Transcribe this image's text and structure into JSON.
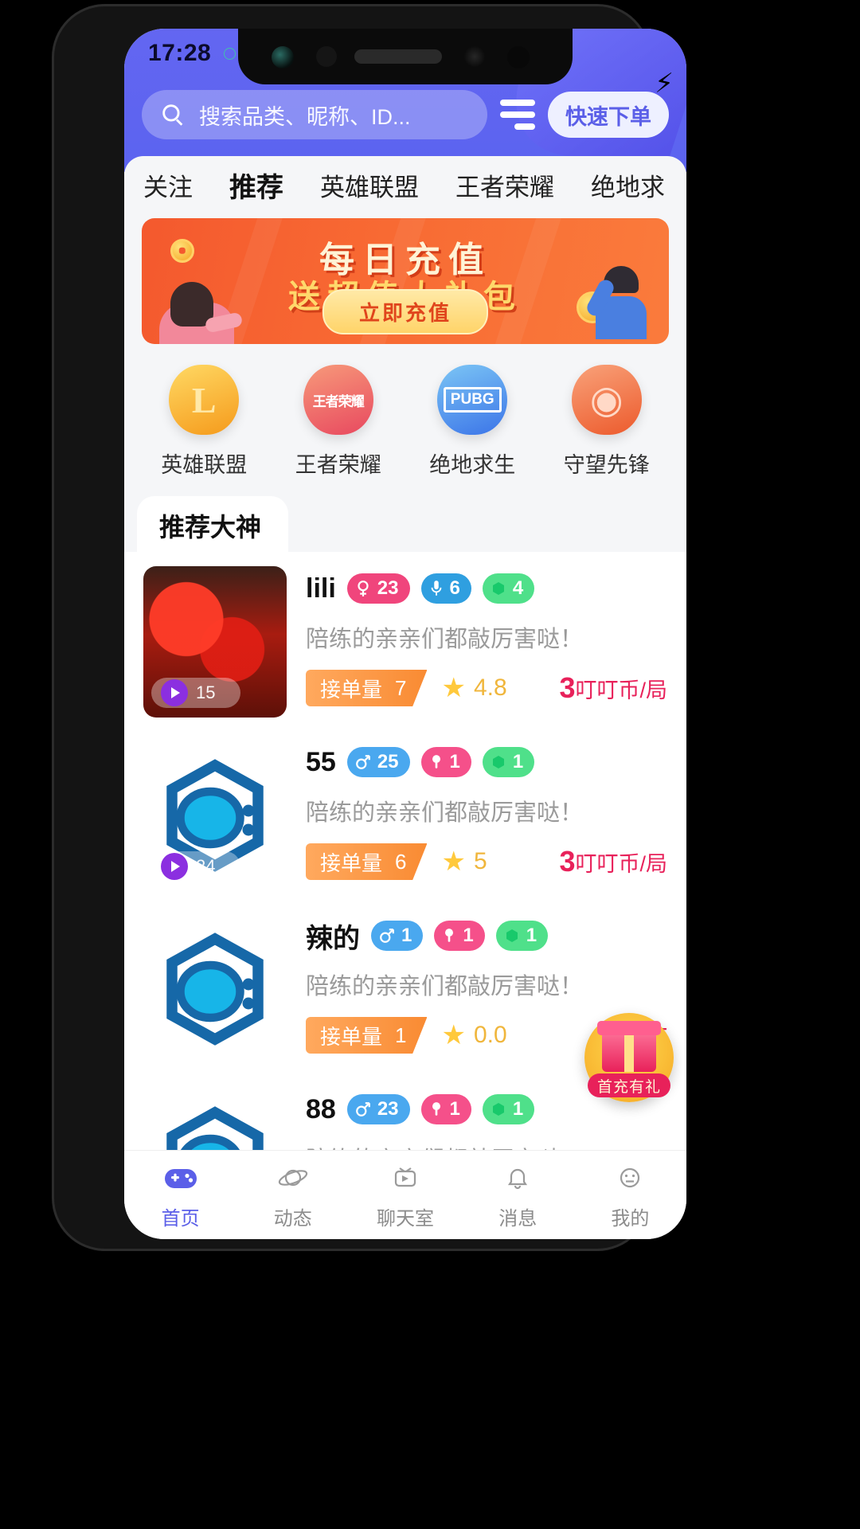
{
  "status_bar": {
    "time": "17:28"
  },
  "header": {
    "search_placeholder": "搜索品类、昵称、ID...",
    "search_icon": "search-icon",
    "menu_icon": "hamburger-menu-icon",
    "quick_order_label": "快速下单",
    "quick_order_icon": "lightning-bolt-icon"
  },
  "tabs": [
    {
      "label": "关注",
      "active": false
    },
    {
      "label": "推荐",
      "active": true
    },
    {
      "label": "英雄联盟",
      "active": false
    },
    {
      "label": "王者荣耀",
      "active": false
    },
    {
      "label": "绝地求",
      "active": false
    }
  ],
  "banner": {
    "title_line1": "每日充值",
    "title_line2": "送超值大礼包",
    "cta_label": "立即充值"
  },
  "game_categories": [
    {
      "label": "英雄联盟",
      "glyph": "L",
      "icon": "lol-game-icon"
    },
    {
      "label": "王者荣耀",
      "glyph": "王者荣耀",
      "icon": "honor-of-kings-game-icon"
    },
    {
      "label": "绝地求生",
      "glyph": "PUBG",
      "icon": "pubg-game-icon"
    },
    {
      "label": "守望先锋",
      "glyph": "◉",
      "icon": "overwatch-game-icon"
    }
  ],
  "recommend": {
    "section_title": "推荐大神",
    "users": [
      {
        "name": "lili",
        "desc": "陪练的亲亲们都敲厉害哒！",
        "avatar_type": "photo",
        "video_duration": "15",
        "badges": [
          {
            "type": "gender-f",
            "icon": "female-icon",
            "value": "23"
          },
          {
            "type": "mic",
            "icon": "microphone-icon",
            "value": "6"
          },
          {
            "type": "green",
            "icon": "gem-icon",
            "value": "4"
          }
        ],
        "order_label": "接单量",
        "order_count": "7",
        "rating": "4.8",
        "price_num": "3",
        "price_unit": "叮叮币/局"
      },
      {
        "name": "55",
        "desc": "陪练的亲亲们都敲厉害哒！",
        "avatar_type": "default",
        "video_duration": "24",
        "badges": [
          {
            "type": "gender-m",
            "icon": "male-icon",
            "value": "25"
          },
          {
            "type": "pink",
            "icon": "medal-icon",
            "value": "1"
          },
          {
            "type": "green",
            "icon": "gem-icon",
            "value": "1"
          }
        ],
        "order_label": "接单量",
        "order_count": "6",
        "rating": "5",
        "price_num": "3",
        "price_unit": "叮叮币/局"
      },
      {
        "name": "辣的",
        "desc": "陪练的亲亲们都敲厉害哒！",
        "avatar_type": "default",
        "video_duration": "",
        "badges": [
          {
            "type": "gender-m",
            "icon": "male-icon",
            "value": "1"
          },
          {
            "type": "pink",
            "icon": "medal-icon",
            "value": "1"
          },
          {
            "type": "green",
            "icon": "gem-icon",
            "value": "1"
          }
        ],
        "order_label": "接单量",
        "order_count": "1",
        "rating": "0.0",
        "price_num": "3",
        "price_unit": "叮叮"
      },
      {
        "name": "88",
        "desc": "陪练的亲亲们都敲厉害哒！",
        "avatar_type": "default",
        "video_duration": "",
        "badges": [
          {
            "type": "gender-m",
            "icon": "male-icon",
            "value": "23"
          },
          {
            "type": "pink",
            "icon": "medal-icon",
            "value": "1"
          },
          {
            "type": "green",
            "icon": "gem-icon",
            "value": "1"
          }
        ],
        "order_label": "",
        "order_count": "",
        "rating": "",
        "price_num": "",
        "price_unit": ""
      }
    ]
  },
  "floating_gift": {
    "label": "首充有礼",
    "icon": "gift-box-icon"
  },
  "bottom_nav": [
    {
      "label": "首页",
      "icon": "gamepad-icon",
      "active": true
    },
    {
      "label": "动态",
      "icon": "planet-icon",
      "active": false
    },
    {
      "label": "聊天室",
      "icon": "broadcast-icon",
      "active": false
    },
    {
      "label": "消息",
      "icon": "bell-icon",
      "active": false
    },
    {
      "label": "我的",
      "icon": "face-icon",
      "active": false
    }
  ],
  "colors": {
    "header_purple": "#5b63f0",
    "accent_pink": "#e8215a",
    "orange_tag": "#f98b33",
    "banner_red": "#f4592e"
  }
}
